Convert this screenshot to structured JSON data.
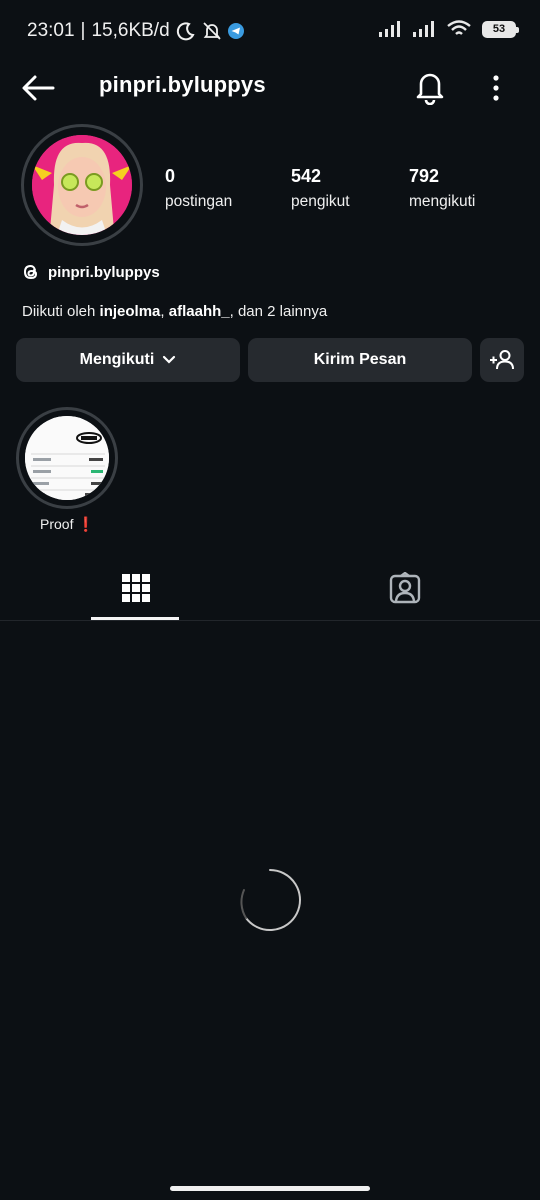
{
  "status_bar": {
    "time": "23:01",
    "net_speed": "15,6KB/d",
    "battery_level": "53"
  },
  "header": {
    "username": "pinpri.byluppys"
  },
  "profile": {
    "stats": [
      {
        "value": "0",
        "label": "postingan"
      },
      {
        "value": "542",
        "label": "pengikut"
      },
      {
        "value": "792",
        "label": "mengikuti"
      }
    ],
    "threads_handle": "pinpri.byluppys",
    "followed_by_prefix": "Diikuti oleh",
    "followed_by_user1": "injeolma",
    "followed_by_sep": ",",
    "followed_by_user2": "aflaahh_",
    "followed_by_suffix": ", dan",
    "followed_by_others": "2 lainnya"
  },
  "actions": {
    "following_label": "Mengikuti",
    "message_label": "Kirim Pesan"
  },
  "highlight": {
    "label": "Proof",
    "emoji": "❗"
  },
  "colors": {
    "background": "#0c1014",
    "button_bg": "#262a2f",
    "accent_telegram": "#3a9be0"
  }
}
